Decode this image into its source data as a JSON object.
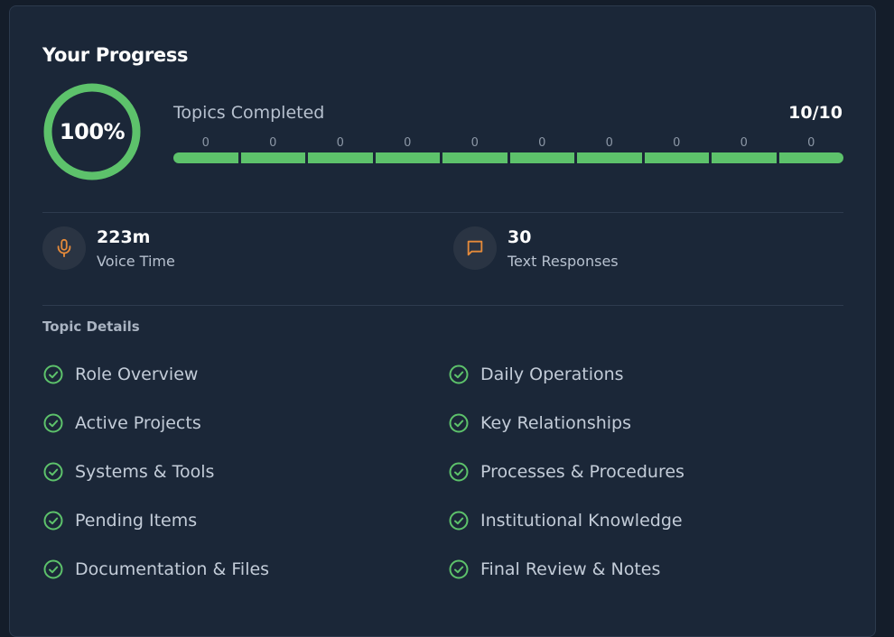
{
  "progress": {
    "title": "Your Progress",
    "percent_label": "100%",
    "percent_value": 1.0,
    "topics_label": "Topics Completed",
    "topics_count": "10/10",
    "segments": [
      {
        "count": "0",
        "fill": 1.0
      },
      {
        "count": "0",
        "fill": 1.0
      },
      {
        "count": "0",
        "fill": 1.0
      },
      {
        "count": "0",
        "fill": 1.0
      },
      {
        "count": "0",
        "fill": 1.0
      },
      {
        "count": "0",
        "fill": 1.0
      },
      {
        "count": "0",
        "fill": 1.0
      },
      {
        "count": "0",
        "fill": 1.0
      },
      {
        "count": "0",
        "fill": 1.0
      },
      {
        "count": "0",
        "fill": 1.0
      }
    ]
  },
  "stats": {
    "voice": {
      "value": "223m",
      "label": "Voice Time",
      "icon": "microphone-icon",
      "color": "#e58a3a"
    },
    "text": {
      "value": "30",
      "label": "Text Responses",
      "icon": "chat-bubble-icon",
      "color": "#e58a3a"
    }
  },
  "details": {
    "section_label": "Topic Details",
    "left": [
      "Role Overview",
      "Active Projects",
      "Systems & Tools",
      "Pending Items",
      "Documentation & Files"
    ],
    "right": [
      "Daily Operations",
      "Key Relationships",
      "Processes & Procedures",
      "Institutional Knowledge",
      "Final Review & Notes"
    ]
  },
  "colors": {
    "accent_green": "#5dc26b",
    "accent_orange": "#e58a3a",
    "card_bg": "#1b2738"
  }
}
